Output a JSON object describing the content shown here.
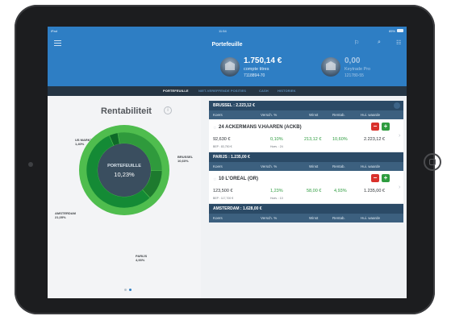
{
  "status": {
    "carrier": "iPad",
    "time": "11:54",
    "battery": "85%"
  },
  "header": {
    "title": "Portefeuille"
  },
  "accounts": [
    {
      "amount": "1.750,14 €",
      "name": "compte titres",
      "number": "7118894-70"
    },
    {
      "amount": "0,00",
      "name": "Keytrade Pro",
      "number": "121780-55"
    }
  ],
  "tabs": [
    "PORTEFEUILLE",
    "NIET-VEREFFENDE POSITIES",
    "CASH",
    "HISTORIEK"
  ],
  "rentabiliteit": {
    "title": "Rentabiliteit",
    "center_label": "PORTEFEUILLE",
    "center_value": "10,23%",
    "segments": [
      {
        "name": "BRUSSEL",
        "value": "10,60%",
        "pct": 10.6,
        "color": "#2f9a3c"
      },
      {
        "name": "PARIJS",
        "value": "4,93%",
        "pct": 4.93,
        "color": "#1d7a2e"
      },
      {
        "name": "AMSTERDAM",
        "value": "21,05%",
        "pct": 21.05,
        "color": "#148a35"
      },
      {
        "name": "US MARKTEN",
        "value": "1,40%",
        "pct": 1.4,
        "color": "#0e6a28"
      }
    ],
    "ring_color": "#4fbd4e"
  },
  "columns": [
    "Koers",
    "Versch. %",
    "Winst",
    "Rentab.",
    "Hui. waarde"
  ],
  "sections": [
    {
      "title": "BRUSSEL : 2.223,12 €",
      "row": {
        "name": "24  ACKERMANS V.HAAREN (ACKB)",
        "koers": "92,630 €",
        "versch": "0,10%",
        "winst": "213,12 €",
        "rentab": "10,60%",
        "waarde": "2.223,12 €",
        "sub1": "BEP : 83,750 €",
        "sub2": "Hoev. : 24"
      }
    },
    {
      "title": "PARIJS : 1.235,00 €",
      "row": {
        "name": "10  L'OREAL (OR)",
        "koers": "123,500 €",
        "versch": "1,23%",
        "winst": "58,00 €",
        "rentab": "4,93%",
        "waarde": "1.235,00 €",
        "sub1": "BEP : 117,700 €",
        "sub2": "Hoev. : 10"
      }
    },
    {
      "title": "AMSTERDAM : 1.628,00 €"
    }
  ],
  "buttons": {
    "minus": "−",
    "plus": "+"
  },
  "icons": {
    "star": "☆",
    "chevron": "›",
    "info": "i"
  }
}
